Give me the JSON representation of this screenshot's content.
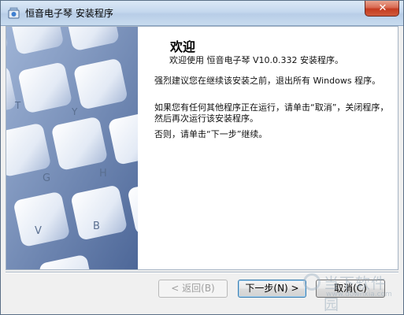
{
  "window": {
    "title": "恒音电子琴 安装程序",
    "close_label": "✕"
  },
  "content": {
    "heading": "欢迎",
    "intro": "欢迎使用 恒音电子琴 V10.0.332 安装程序。",
    "para1": "强烈建议您在继续该安装之前，退出所有 Windows 程序。",
    "para2": "如果您有任何其他程序正在运行，请单击“取消”，关闭程序，然后再次运行该安装程序。",
    "para3": "否则，请单击“下一步”继续。"
  },
  "side_image": {
    "keys": [
      "T",
      "Y",
      "G",
      "H",
      "V",
      "B"
    ]
  },
  "buttons": {
    "back": "< 返回(B)",
    "next": "下一步(N) >",
    "cancel": "取消(C)"
  },
  "watermark": {
    "text": "当下软件园",
    "url": "www.downxia.com"
  }
}
